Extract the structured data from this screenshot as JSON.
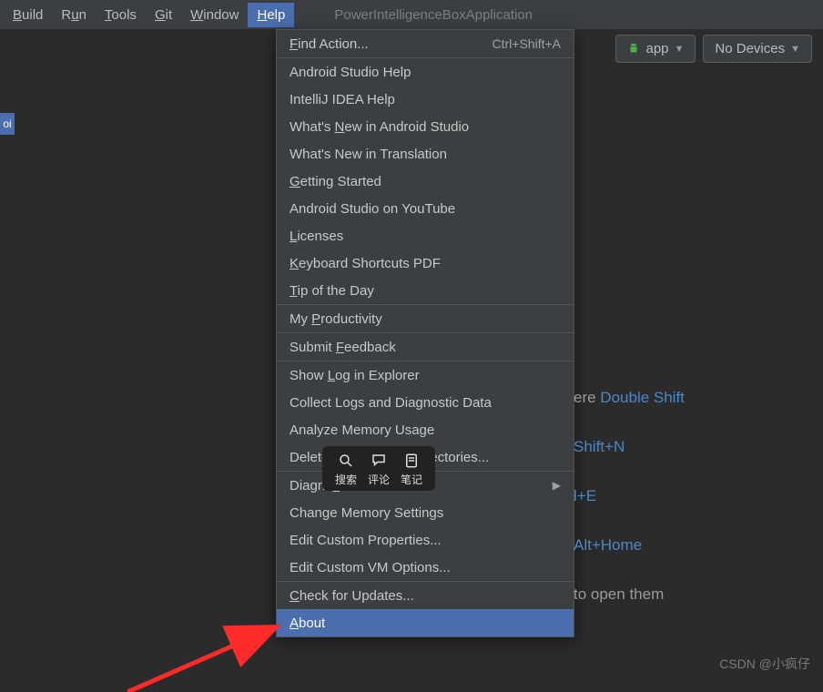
{
  "menubar": {
    "items": [
      "Build",
      "Run",
      "Tools",
      "Git",
      "Window",
      "Help"
    ],
    "activeIndex": 5,
    "appTitle": "PowerIntelligenceBoxApplication"
  },
  "toolbar": {
    "appSelector": "app",
    "deviceSelector": "No Devices"
  },
  "edgeTab": "oi",
  "helpMenu": {
    "items": [
      {
        "type": "item",
        "label": "Find Action...",
        "mnemonic": "F",
        "shortcut": "Ctrl+Shift+A"
      },
      {
        "type": "sep"
      },
      {
        "type": "item",
        "label": "Android Studio Help"
      },
      {
        "type": "item",
        "label": "IntelliJ IDEA Help"
      },
      {
        "type": "item",
        "label": "What's New in Android Studio",
        "mnemonic": "N"
      },
      {
        "type": "item",
        "label": "What's New in Translation"
      },
      {
        "type": "item",
        "label": "Getting Started",
        "mnemonic": "G"
      },
      {
        "type": "item",
        "label": "Android Studio on YouTube"
      },
      {
        "type": "item",
        "label": "Licenses",
        "mnemonic": "L"
      },
      {
        "type": "item",
        "label": "Keyboard Shortcuts PDF",
        "mnemonic": "K"
      },
      {
        "type": "item",
        "label": "Tip of the Day",
        "mnemonic": "T"
      },
      {
        "type": "sep"
      },
      {
        "type": "item",
        "label": "My Productivity",
        "mnemonic": "P"
      },
      {
        "type": "sep"
      },
      {
        "type": "item",
        "label": "Submit Feedback",
        "mnemonic": "F"
      },
      {
        "type": "sep"
      },
      {
        "type": "item",
        "label": "Show Log in Explorer",
        "mnemonic": "L"
      },
      {
        "type": "item",
        "label": "Collect Logs and Diagnostic Data"
      },
      {
        "type": "item",
        "label": "Analyze Memory Usage"
      },
      {
        "type": "item",
        "label": "Delete Leftover IDE Directories..."
      },
      {
        "type": "sep"
      },
      {
        "type": "item",
        "label": "Diagnostic Tools",
        "mnemonic": "s",
        "submenu": true
      },
      {
        "type": "item",
        "label": "Change Memory Settings"
      },
      {
        "type": "item",
        "label": "Edit Custom Properties..."
      },
      {
        "type": "item",
        "label": "Edit Custom VM Options..."
      },
      {
        "type": "sep"
      },
      {
        "type": "item",
        "label": "Check for Updates...",
        "mnemonic": "C"
      },
      {
        "type": "item",
        "label": "About",
        "mnemonic": "A",
        "highlight": true
      }
    ]
  },
  "welcome": {
    "hints": [
      {
        "suffix": "ere",
        "key": "Double Shift"
      },
      {
        "suffix": "",
        "key": "Shift+N"
      },
      {
        "suffix": "",
        "key": "l+E"
      },
      {
        "suffix": "",
        "key": "Alt+Home"
      },
      {
        "suffix": "to open them",
        "key": ""
      }
    ]
  },
  "floater": {
    "items": [
      {
        "label": "搜索",
        "icon": "search"
      },
      {
        "label": "评论",
        "icon": "comment"
      },
      {
        "label": "笔记",
        "icon": "note"
      }
    ]
  },
  "watermark": "CSDN @小疯仔"
}
